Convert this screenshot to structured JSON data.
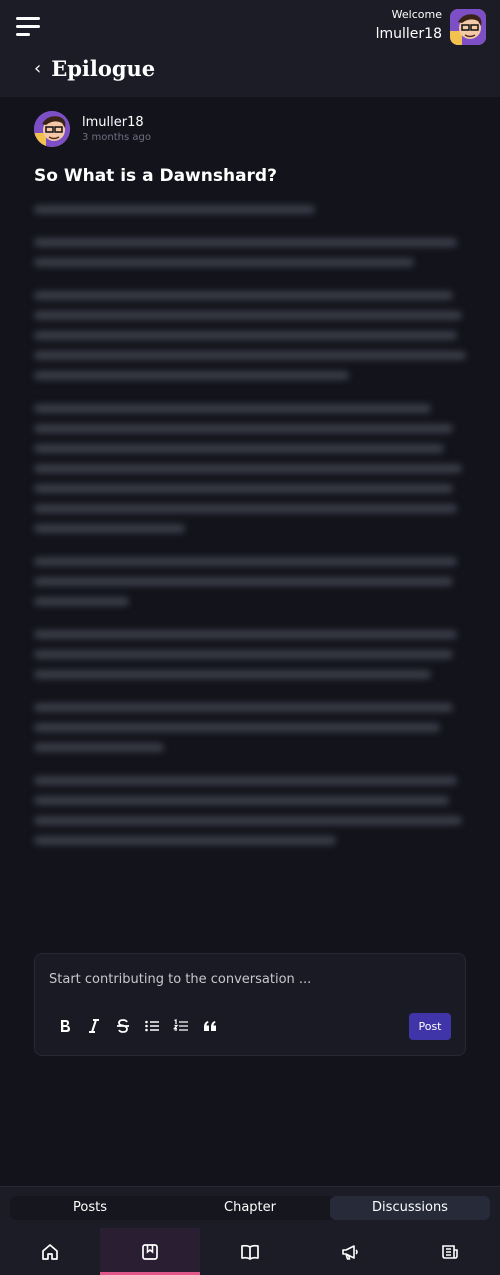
{
  "header": {
    "welcome_label": "Welcome",
    "username": "lmuller18",
    "page_title": "Epilogue"
  },
  "post": {
    "author": "lmuller18",
    "time_ago": "3 months ago",
    "title": "So What is a Dawnshard?"
  },
  "comment": {
    "placeholder": "Start contributing to the conversation ...",
    "post_label": "Post"
  },
  "tabs": [
    {
      "label": "Posts",
      "active": false
    },
    {
      "label": "Chapter",
      "active": false
    },
    {
      "label": "Discussions",
      "active": true
    }
  ],
  "nav": [
    {
      "icon": "home-icon",
      "active": false
    },
    {
      "icon": "bookmark-icon",
      "active": true
    },
    {
      "icon": "book-open-icon",
      "active": false
    },
    {
      "icon": "megaphone-icon",
      "active": false
    },
    {
      "icon": "newspaper-icon",
      "active": false
    }
  ],
  "colors": {
    "background": "#12131b",
    "surface": "#1b1c25",
    "post_button": "#3f35a8",
    "nav_active_indicator": "#e0578a"
  }
}
